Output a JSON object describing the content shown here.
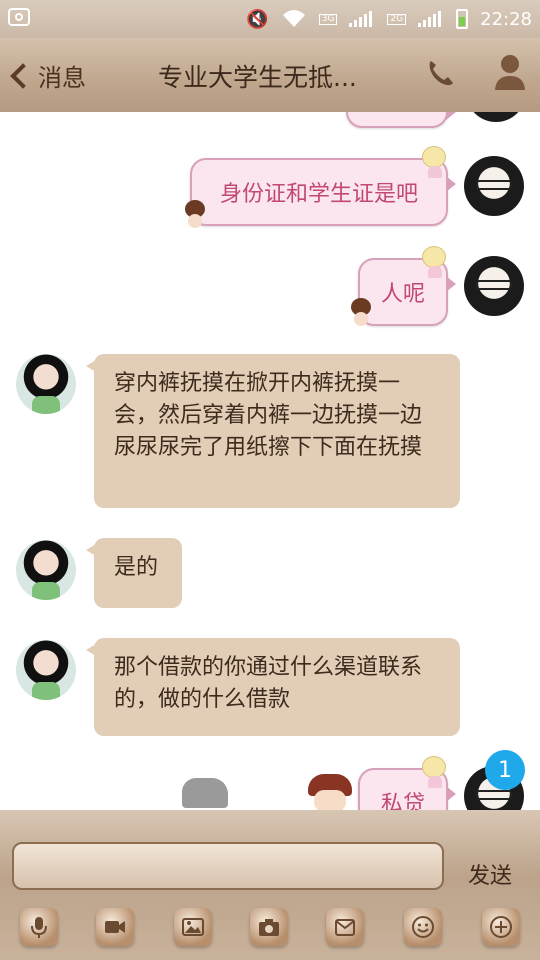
{
  "status_bar": {
    "time": "22:28",
    "network_1": "3G",
    "network_2": "2G",
    "icons": [
      "screenshot-icon",
      "mute-icon",
      "wifi-icon",
      "signal-icon",
      "battery-icon"
    ]
  },
  "header": {
    "back_label": "消息",
    "title": "专业大学生无抵..."
  },
  "messages": [
    {
      "side": "right",
      "text": "身份证和学生证是吧"
    },
    {
      "side": "right",
      "text": "人呢"
    },
    {
      "side": "left",
      "text": "穿内裤抚摸在掀开内裤抚摸一会，然后穿着内裤一边抚摸一边尿尿尿完了用纸擦下下面在抚摸"
    },
    {
      "side": "left",
      "text": "是的"
    },
    {
      "side": "left",
      "text": "那个借款的你通过什么渠道联系的，做的什么借款"
    },
    {
      "side": "right",
      "text": "私贷"
    }
  ],
  "unread_badge": "1",
  "composer": {
    "send_label": "发送",
    "input_value": ""
  },
  "toolbar_icons": [
    "microphone-icon",
    "video-icon",
    "image-icon",
    "camera-icon",
    "envelope-icon",
    "emoji-icon",
    "plus-icon"
  ],
  "colors": {
    "accent": "#1fa8ea",
    "bubble_left": "#e2cdb6",
    "bubble_right": "#fbe6f0",
    "bubble_right_text": "#c24874",
    "header_bg": "#bfa68d"
  }
}
